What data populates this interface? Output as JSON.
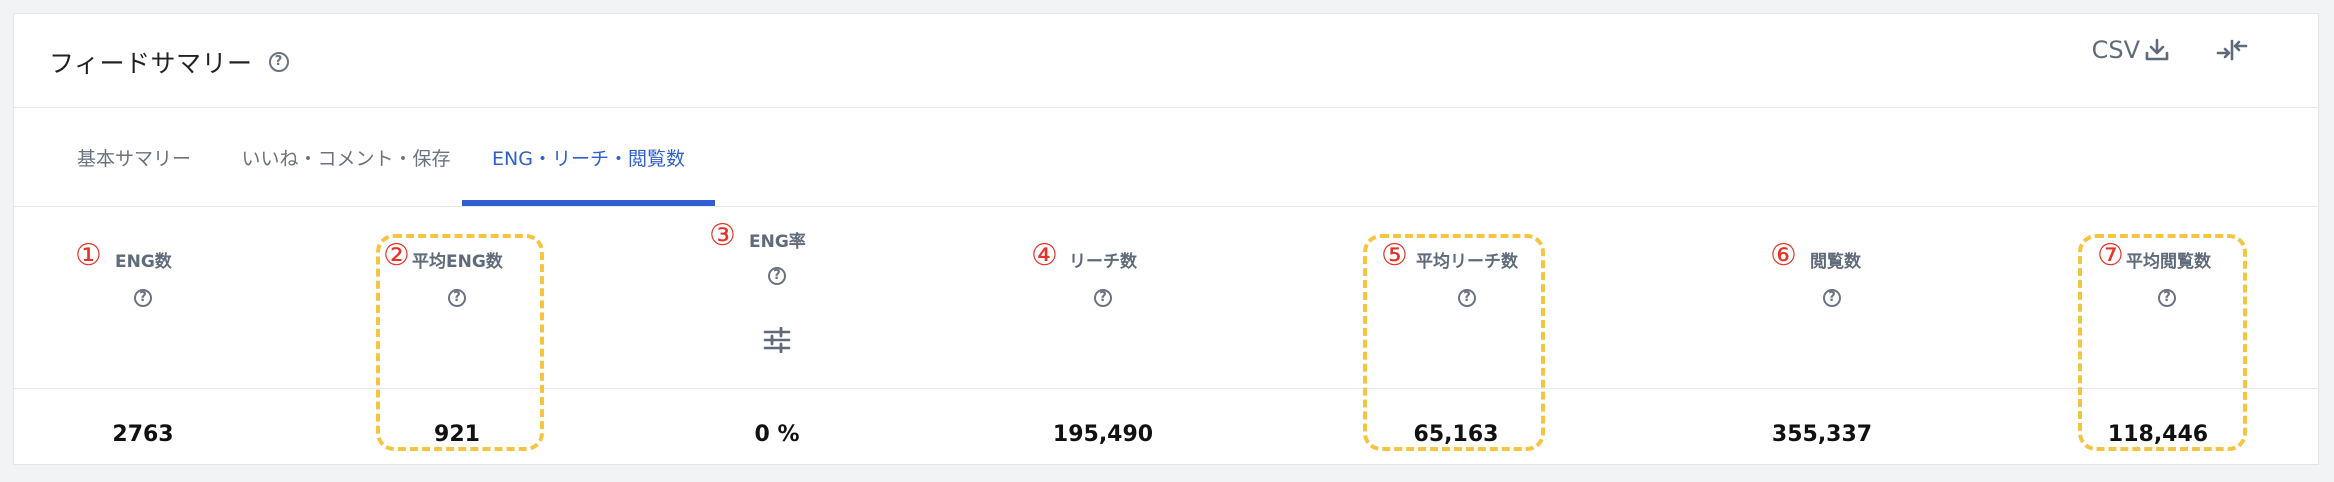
{
  "header": {
    "title": "フィードサマリー",
    "help_icon": "question-circle-icon",
    "csv_label": "CSV",
    "csv_icon": "download-icon",
    "collapse_icon": "collapse-arrows-icon"
  },
  "tabs": [
    {
      "label": "基本サマリー",
      "active": false
    },
    {
      "label": "いいね・コメント・保存",
      "active": false
    },
    {
      "label": "ENG・リーチ・閲覧数",
      "active": true
    }
  ],
  "colors": {
    "accent": "#2f5fd0",
    "annotation_red": "#e5332a",
    "highlight_dash": "#f5c542"
  },
  "metrics": [
    {
      "mark": "①",
      "label": "ENG数",
      "value": "2763",
      "highlighted": false
    },
    {
      "mark": "②",
      "label": "平均ENG数",
      "value": "921",
      "highlighted": true
    },
    {
      "mark": "③",
      "label": "ENG率",
      "value": "0 %",
      "highlighted": false,
      "has_filter": true
    },
    {
      "mark": "④",
      "label": "リーチ数",
      "value": "195,490",
      "highlighted": false
    },
    {
      "mark": "⑤",
      "label": "平均リーチ数",
      "value": "65,163",
      "highlighted": true
    },
    {
      "mark": "⑥",
      "label": "閲覧数",
      "value": "355,337",
      "highlighted": false
    },
    {
      "mark": "⑦",
      "label": "平均閲覧数",
      "value": "118,446",
      "highlighted": true
    }
  ]
}
